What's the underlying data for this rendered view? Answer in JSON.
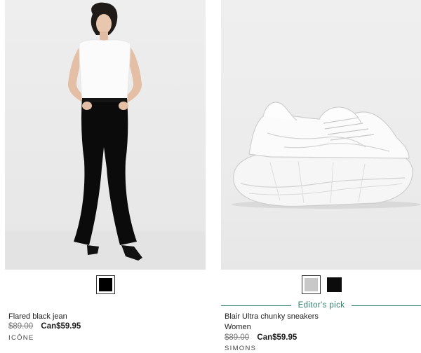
{
  "products": [
    {
      "name": "Flared black jean",
      "subtitle": "",
      "editor_pick": "",
      "original_price": "$89.00",
      "sale_price": "Can$59.95",
      "brand": "ICÔNE",
      "image": "model-white-tank-black-flared-jeans",
      "swatches": [
        {
          "color": "#000000",
          "selected": true
        }
      ]
    },
    {
      "name": "Blair Ultra chunky sneakers",
      "subtitle": "Women",
      "editor_pick": "Editor's pick",
      "original_price": "$89.00",
      "sale_price": "Can$59.95",
      "brand": "SIMONS",
      "image": "white-chunky-sneaker",
      "swatches": [
        {
          "color": "#c8c8c8",
          "selected": true
        },
        {
          "color": "#0c0c0c",
          "selected": false
        }
      ]
    }
  ],
  "colors": {
    "accent_green": "#2e7f6a",
    "strike_gray": "#777777"
  }
}
